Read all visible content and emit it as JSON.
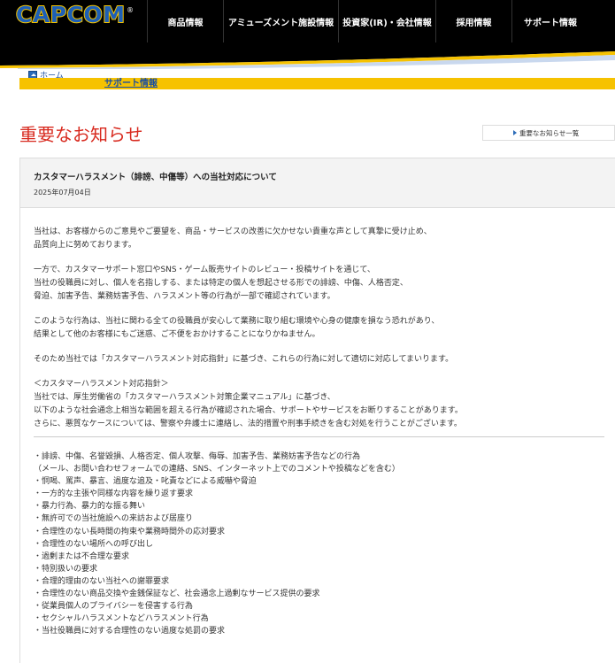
{
  "header": {
    "logo_text": "CAPCOM",
    "logo_reg": "®",
    "nav": [
      "商品情報",
      "アミューズメント施設情報",
      "投資家(IR)・会社情報",
      "採用情報",
      "サポート情報"
    ]
  },
  "breadcrumb": {
    "home": "ホーム",
    "current": "サポート情報"
  },
  "page": {
    "title": "重要なお知らせ",
    "list_button": "重要なお知らせ一覧"
  },
  "article": {
    "title": "カスタマーハラスメント（誹謗、中傷等）への当社対応について",
    "date": "2025年07月04日",
    "paragraphs": [
      "当社は、お客様からのご意見やご要望を、商品・サービスの改善に欠かせない貴重な声として真摯に受け止め、\n品質向上に努めております。",
      "一方で、カスタマーサポート窓口やSNS・ゲーム販売サイトのレビュー・投稿サイトを通じて、\n当社の役職員に対し、個人を名指しする、または特定の個人を想起させる形での誹謗、中傷、人格否定、\n脅迫、加害予告、業務妨害予告、ハラスメント等の行為が一部で確認されています。",
      "このような行為は、当社に関わる全ての役職員が安心して業務に取り組む環境や心身の健康を損なう恐れがあり、\n結果として他のお客様にもご迷惑、ご不便をおかけすることになりかねません。",
      "そのため当社では「カスタマーハラスメント対応指針」に基づき、これらの行為に対して適切に対応してまいります。",
      "＜カスタマーハラスメント対応指針＞\n当社では、厚生労働省の「カスタマーハラスメント対策企業マニュアル」に基づき、\n以下のような社会通念上相当な範囲を超える行為が確認された場合、サポートやサービスをお断りすることがあります。\nさらに、悪質なケースについては、警察や弁護士に連絡し、法的措置や刑事手続きを含む対処を行うことがございます。"
    ],
    "items": [
      "・誹謗、中傷、名誉毀損、人格否定、個人攻撃、侮辱、加害予告、業務妨害予告などの行為",
      "（メール、お問い合わせフォームでの連絡、SNS、インターネット上でのコメントや投稿などを含む）",
      "・恫喝、罵声、暴言、過度な追及・叱責などによる威嚇や脅迫",
      "・一方的な主張や同様な内容を繰り返す要求",
      "・暴力行為、暴力的な振る舞い",
      "・無許可での当社施設への来訪および居座り",
      "・合理性のない長時間の拘束や業務時間外の応対要求",
      "・合理性のない場所への呼び出し",
      "・過剰または不合理な要求",
      "・特別扱いの要求",
      "・合理的理由のない当社への謝罪要求",
      "・合理性のない商品交換や金銭保証など、社会通念上過剰なサービス提供の要求",
      "・従業員個人のプライバシーを侵害する行為",
      "・セクシャルハラスメントなどハラスメント行為",
      "・当社役職員に対する合理性のない過度な処罰の要求"
    ]
  }
}
